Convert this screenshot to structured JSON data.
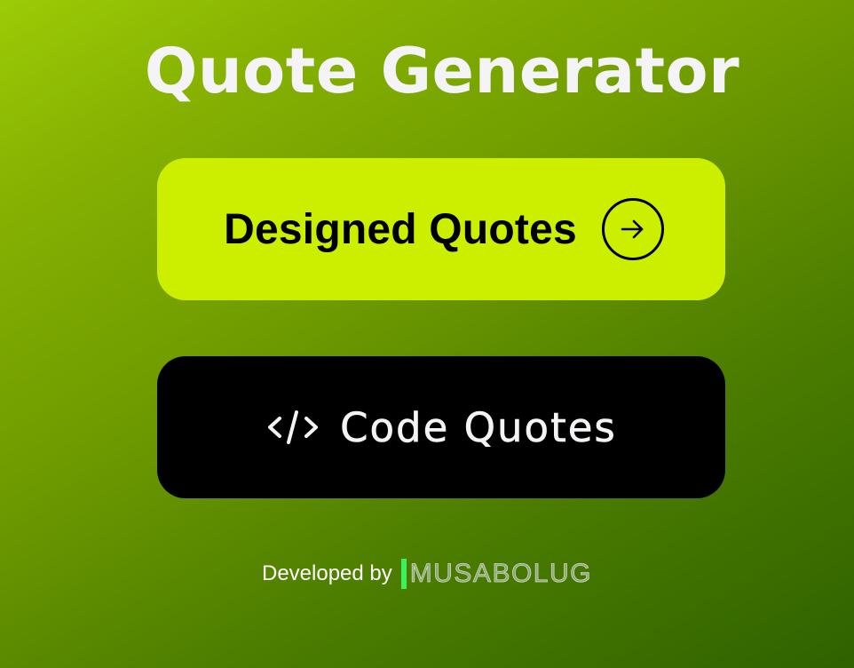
{
  "header": {
    "title": "Quote Generator"
  },
  "buttons": {
    "designed_label": "Designed Quotes",
    "designed_icon": "arrow-right-circle-icon",
    "code_label": "Code Quotes",
    "code_icon": "code-brackets-icon"
  },
  "footer": {
    "prefix": "Developed by",
    "brand": "MUSABOLUG"
  },
  "colors": {
    "background_top": "#9ccb06",
    "background_bottom": "#2f6200",
    "designed_button": "#ccef00",
    "code_button": "#000000",
    "brand_bar": "#3df05d"
  }
}
